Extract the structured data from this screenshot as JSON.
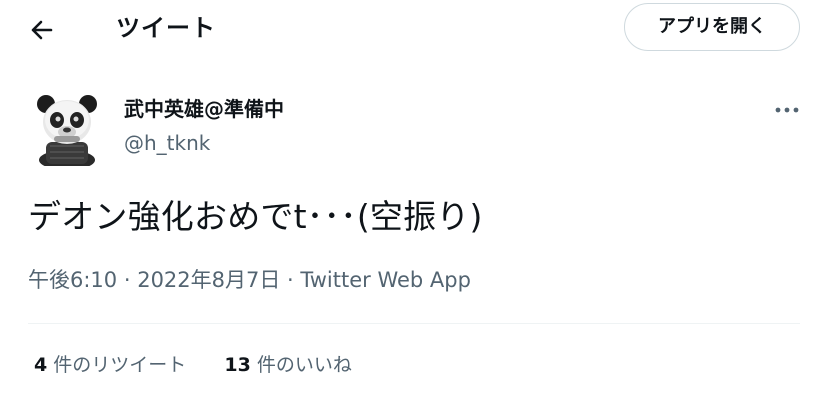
{
  "header": {
    "back_icon": "arrow-left-icon",
    "title": "ツイート",
    "open_app_label": "アプリを開く"
  },
  "tweet": {
    "display_name": "武中英雄@準備中",
    "handle": "@h_tknk",
    "text": "デオン強化おめでt･･･(空振り)",
    "time": "午後6:10",
    "sep1": " · ",
    "date": "2022年8月7日",
    "sep2": " · ",
    "source": "Twitter Web App",
    "more_icon": "more-horizontal-icon"
  },
  "stats": {
    "retweets_count": "4",
    "retweets_label": "件のリツイート",
    "likes_count": "13",
    "likes_label": "件のいいね"
  },
  "colors": {
    "text": "#0f1419",
    "secondary": "#536471",
    "border": "#cfd9de",
    "divider": "#eff3f4"
  }
}
